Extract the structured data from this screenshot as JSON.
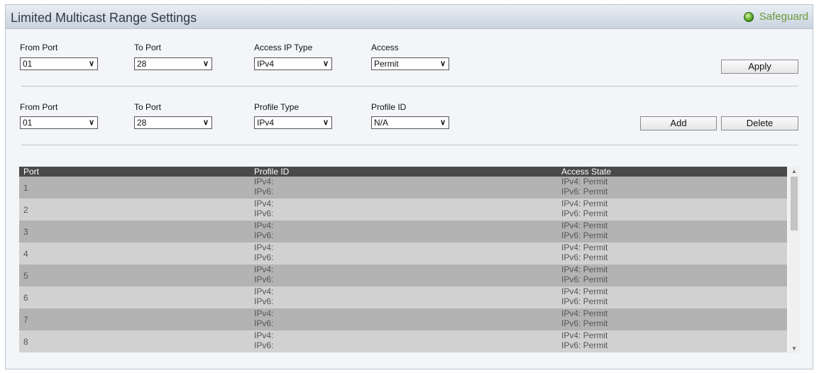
{
  "title": "Limited Multicast Range Settings",
  "safeguard": "Safeguard",
  "form1": {
    "from_port": {
      "label": "From Port",
      "value": "01"
    },
    "to_port": {
      "label": "To Port",
      "value": "28"
    },
    "access_ip_type": {
      "label": "Access IP Type",
      "value": "IPv4"
    },
    "access": {
      "label": "Access",
      "value": "Permit"
    },
    "apply": "Apply"
  },
  "form2": {
    "from_port": {
      "label": "From Port",
      "value": "01"
    },
    "to_port": {
      "label": "To Port",
      "value": "28"
    },
    "profile_type": {
      "label": "Profile Type",
      "value": "IPv4"
    },
    "profile_id": {
      "label": "Profile ID",
      "value": "N/A"
    },
    "add": "Add",
    "delete": "Delete"
  },
  "table": {
    "headers": [
      "Port",
      "Profile ID",
      "Access State"
    ],
    "rows": [
      {
        "port": "1",
        "pid": [
          "IPv4:",
          "IPv6:"
        ],
        "acc": [
          "IPv4: Permit",
          "IPv6: Permit"
        ]
      },
      {
        "port": "2",
        "pid": [
          "IPv4:",
          "IPv6:"
        ],
        "acc": [
          "IPv4: Permit",
          "IPv6: Permit"
        ]
      },
      {
        "port": "3",
        "pid": [
          "IPv4:",
          "IPv6:"
        ],
        "acc": [
          "IPv4: Permit",
          "IPv6: Permit"
        ]
      },
      {
        "port": "4",
        "pid": [
          "IPv4:",
          "IPv6:"
        ],
        "acc": [
          "IPv4: Permit",
          "IPv6: Permit"
        ]
      },
      {
        "port": "5",
        "pid": [
          "IPv4:",
          "IPv6:"
        ],
        "acc": [
          "IPv4: Permit",
          "IPv6: Permit"
        ]
      },
      {
        "port": "6",
        "pid": [
          "IPv4:",
          "IPv6:"
        ],
        "acc": [
          "IPv4: Permit",
          "IPv6: Permit"
        ]
      },
      {
        "port": "7",
        "pid": [
          "IPv4:",
          "IPv6:"
        ],
        "acc": [
          "IPv4: Permit",
          "IPv6: Permit"
        ]
      },
      {
        "port": "8",
        "pid": [
          "IPv4:",
          "IPv6:"
        ],
        "acc": [
          "IPv4: Permit",
          "IPv6: Permit"
        ]
      }
    ]
  },
  "scrollbar": {
    "up": "▲",
    "down": "▼"
  }
}
